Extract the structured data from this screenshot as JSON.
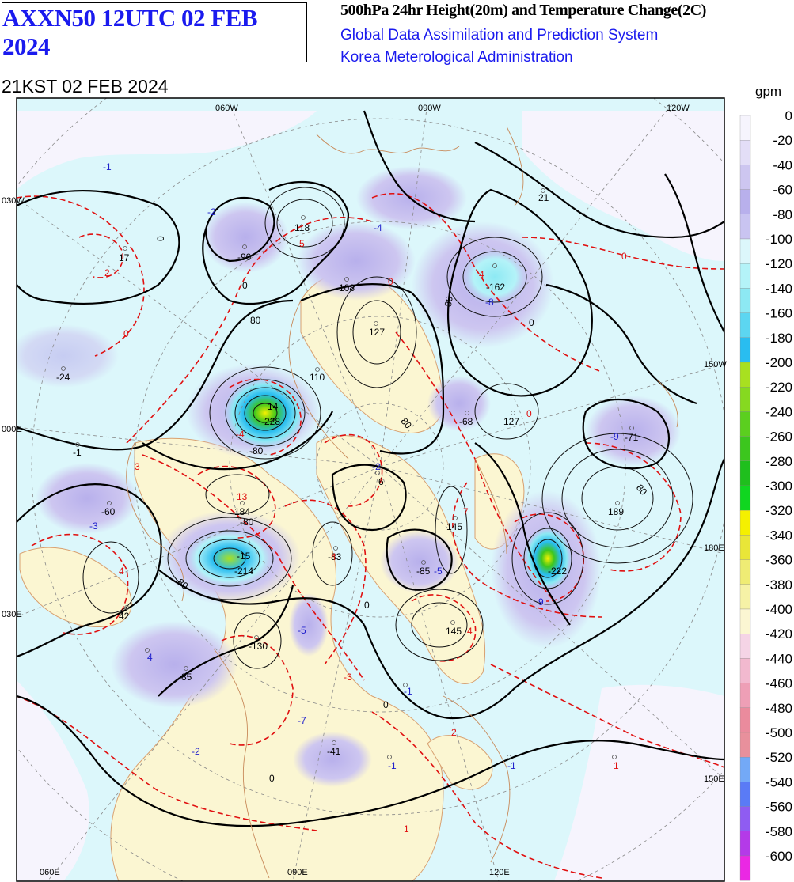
{
  "header": {
    "chart_id": "AXXN50 12UTC 02 FEB 2024",
    "product": "500hPa 24hr Height(20m) and Temperature Change(2C)",
    "system": "Global Data Assimilation and Prediction System",
    "agency": "Korea Meterological Administration",
    "valid_time": "21KST 02 FEB 2024"
  },
  "legend": {
    "unit": "gpm",
    "levels": [
      {
        "label": "0",
        "color": "#f6f4fd"
      },
      {
        "label": "-20",
        "color": "#e3def7"
      },
      {
        "label": "-40",
        "color": "#cdc6f0"
      },
      {
        "label": "-60",
        "color": "#b8b0ec"
      },
      {
        "label": "-80",
        "color": "#c9c4f1"
      },
      {
        "label": "-100",
        "color": "#dcf7fb"
      },
      {
        "label": "-120",
        "color": "#b4f3f8"
      },
      {
        "label": "-140",
        "color": "#8de9f3"
      },
      {
        "label": "-160",
        "color": "#5cd6f1"
      },
      {
        "label": "-180",
        "color": "#29bdf0"
      },
      {
        "label": "-200",
        "color": "#a8e020"
      },
      {
        "label": "-220",
        "color": "#86d920"
      },
      {
        "label": "-240",
        "color": "#5bcf1f"
      },
      {
        "label": "-260",
        "color": "#3cc61e"
      },
      {
        "label": "-280",
        "color": "#1fbf1d"
      },
      {
        "label": "-300",
        "color": "#10d620"
      },
      {
        "label": "-320",
        "color": "#f5f000"
      },
      {
        "label": "-340",
        "color": "#e9e638"
      },
      {
        "label": "-360",
        "color": "#efec74"
      },
      {
        "label": "-380",
        "color": "#f6f2a6"
      },
      {
        "label": "-400",
        "color": "#fbf6d2"
      },
      {
        "label": "-420",
        "color": "#f5d4e6"
      },
      {
        "label": "-440",
        "color": "#f2b9cf"
      },
      {
        "label": "-460",
        "color": "#ee9fb6"
      },
      {
        "label": "-480",
        "color": "#ea8b9d"
      },
      {
        "label": "-500",
        "color": "#e8909c"
      },
      {
        "label": "-520",
        "color": "#73a9f7"
      },
      {
        "label": "-540",
        "color": "#5a7bf6"
      },
      {
        "label": "-560",
        "color": "#8f5cf2"
      },
      {
        "label": "-580",
        "color": "#b43ae8"
      },
      {
        "label": "-600",
        "color": "#ea28e4"
      }
    ]
  },
  "map": {
    "longitude_labels": [
      "060W",
      "090W",
      "120W",
      "030W",
      "150W",
      "000E",
      "180E",
      "030E",
      "150E",
      "060E",
      "090E",
      "120E"
    ],
    "height_change_labels": [
      "118",
      "-90",
      "17",
      "-108",
      "-162",
      "21",
      "80",
      "127",
      "-24",
      "110",
      "-228",
      "-68",
      "127",
      "-71",
      "-1",
      "-80",
      "6",
      "-60",
      "184",
      "-80",
      "145",
      "189",
      "-214",
      "-83",
      "-85",
      "-222",
      "42",
      "-130",
      "145",
      "-85",
      "-41",
      "-80",
      "80",
      "80",
      "80",
      "0",
      "0",
      "0",
      "0",
      "0",
      "0"
    ],
    "temperature_change_labels": [
      "-1",
      "-2",
      "2",
      "5",
      "-4",
      "4",
      "-8",
      "0",
      "0",
      "0",
      "0",
      "3",
      "-2",
      "-3",
      "13",
      "4",
      "-15",
      "14",
      "-4",
      "7",
      "-5",
      "-9",
      "9",
      "4",
      "-5",
      "-7",
      "-3",
      "-1",
      "-2",
      "-1",
      "-1",
      "1",
      "1",
      "4",
      "4",
      "2"
    ]
  }
}
